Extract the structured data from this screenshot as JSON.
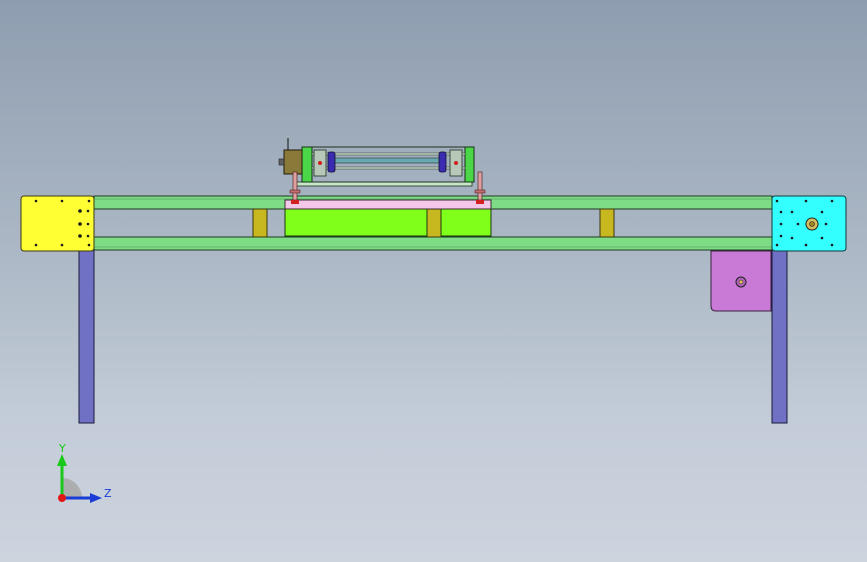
{
  "viewport": {
    "background_top": "#8e9db0",
    "background_bottom": "#ccd4de"
  },
  "model": {
    "parts": {
      "frame_rail": "#7ddc85",
      "left_end_plate": "#ffff33",
      "right_end_plate": "#33ffff",
      "leg": "#7070c4",
      "spacer_block": "#c8b820",
      "slide_block": "#80ff1a",
      "slide_cover": "#f4c6e8",
      "motor_bracket": "#c87ad6",
      "carriage_plate": "#7ddc85",
      "coupling": "#3b2bb0"
    }
  },
  "triad": {
    "y_label": "Y",
    "z_label": "Z",
    "y_color": "#19c919",
    "z_color": "#1a3cd6",
    "x_color": "#e01818"
  }
}
